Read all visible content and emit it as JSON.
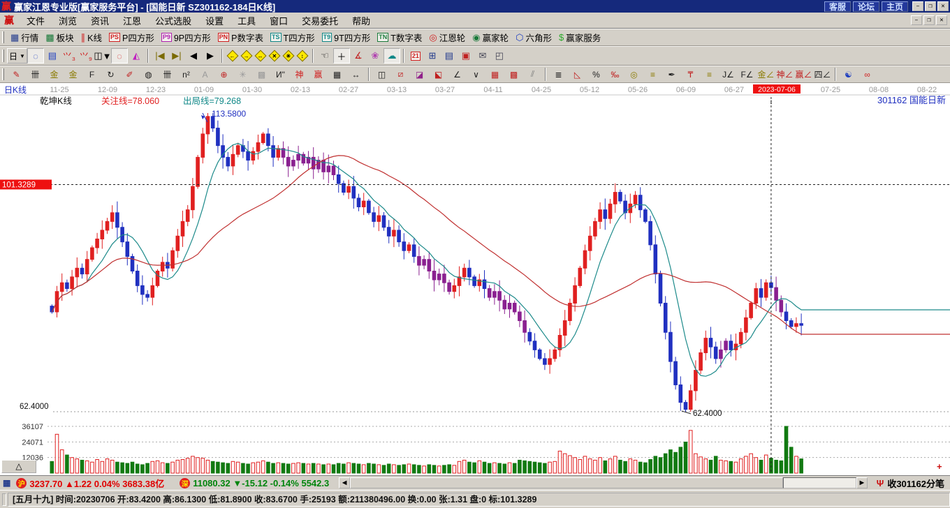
{
  "window": {
    "logo": "赢",
    "title": "赢家江恩专业版[赢家服务平台] - [国能日新  SZ301162-184日K线]",
    "links": [
      {
        "name": "support-link",
        "label": "客服"
      },
      {
        "name": "forum-link",
        "label": "论坛"
      },
      {
        "name": "home-link",
        "label": "主页"
      }
    ],
    "controls": [
      "–",
      "❐",
      "✕"
    ]
  },
  "menu": {
    "logo": "赢",
    "items": [
      {
        "name": "menu-file",
        "label": "文件"
      },
      {
        "name": "menu-browse",
        "label": "浏览"
      },
      {
        "name": "menu-news",
        "label": "资讯"
      },
      {
        "name": "menu-gann",
        "label": "江恩"
      },
      {
        "name": "menu-formula-picker",
        "label": "公式选股"
      },
      {
        "name": "menu-settings",
        "label": "设置"
      },
      {
        "name": "menu-tools",
        "label": "工具"
      },
      {
        "name": "menu-window",
        "label": "窗口"
      },
      {
        "name": "menu-trade",
        "label": "交易委托"
      },
      {
        "name": "menu-help",
        "label": "帮助"
      }
    ]
  },
  "toolbar_main": [
    {
      "name": "quotes-button",
      "icon": "grid-icon",
      "glyph": "▦",
      "color": "#223a8c",
      "label": "行情"
    },
    {
      "name": "sectors-button",
      "icon": "blocks-icon",
      "glyph": "▩",
      "color": "#1a7a3a",
      "label": "板块"
    },
    {
      "name": "kline-button",
      "icon": "candle-icon",
      "glyph": "∥",
      "color": "#d02020",
      "label": "K线"
    },
    {
      "name": "p-square-button",
      "badge": "PS",
      "color": "#d02020",
      "label": "P四方形"
    },
    {
      "name": "p9-square-button",
      "badge": "P9",
      "color": "#b020b0",
      "label": "9P四方形"
    },
    {
      "name": "p-number-table-button",
      "badge": "PN",
      "color": "#d02020",
      "label": "P数字表"
    },
    {
      "name": "t-square-button",
      "badge": "TS",
      "color": "#108888",
      "label": "T四方形"
    },
    {
      "name": "t9-square-button",
      "badge": "T9",
      "color": "#108888",
      "label": "9T四方形"
    },
    {
      "name": "t-number-table-button",
      "badge": "TN",
      "color": "#1a7a3a",
      "label": "T数字表"
    },
    {
      "name": "gann-wheel-button",
      "icon": "gann-wheel-icon",
      "glyph": "◎",
      "color": "#d02020",
      "label": "江恩轮"
    },
    {
      "name": "winner-wheel-button",
      "icon": "winner-wheel-icon",
      "glyph": "◉",
      "color": "#1a7a3a",
      "label": "赢家轮"
    },
    {
      "name": "hexagon-button",
      "icon": "hexagon-icon",
      "glyph": "⬡",
      "color": "#2040c0",
      "label": "六角形"
    },
    {
      "name": "winner-service-button",
      "icon": "dollar-icon",
      "glyph": "$",
      "color": "#2aa82a",
      "label": "赢家服务"
    }
  ],
  "toolbar_nav": {
    "period_label": "日",
    "items": [
      {
        "name": "zoom-select-icon",
        "glyph": "◌",
        "color": "#2040c0",
        "pressed": true
      },
      {
        "name": "info-panel-icon",
        "glyph": "▤",
        "color": "#2040c0"
      },
      {
        "name": "chart3-icon",
        "glyph": "⺍₃",
        "color": "#d02020"
      },
      {
        "name": "chart9-icon",
        "glyph": "⺍₉",
        "color": "#d02020"
      },
      {
        "name": "candle-style-icon",
        "glyph": "◫",
        "color": "#000",
        "caret": true
      },
      {
        "name": "region-lasso-icon",
        "glyph": "◌",
        "color": "#d02020",
        "pressed": true
      },
      {
        "name": "color-chart-icon",
        "glyph": "◭",
        "color": "#c020c0"
      },
      {
        "sep": true
      },
      {
        "name": "first-page-icon",
        "glyph": "|◀",
        "color": "#7a6a00"
      },
      {
        "name": "last-page-icon",
        "glyph": "▶|",
        "color": "#7a6a00"
      },
      {
        "name": "prev-page-icon",
        "glyph": "◀",
        "color": "#000"
      },
      {
        "name": "next-page-icon",
        "glyph": "▶",
        "color": "#000"
      },
      {
        "sep": true
      },
      {
        "name": "shift-left-icon",
        "diamond": true,
        "arrow": "←"
      },
      {
        "name": "shift-right-icon",
        "diamond": true,
        "arrow": "→"
      },
      {
        "name": "expand-h-icon",
        "diamond": true,
        "arrow": "↔"
      },
      {
        "name": "compress-icon",
        "diamond": true,
        "arrow": "✕"
      },
      {
        "name": "zoom-all-icon",
        "diamond": true,
        "arrow": "✳"
      },
      {
        "name": "expand-v-icon",
        "diamond": true,
        "arrow": "↕"
      },
      {
        "sep": true
      },
      {
        "name": "hand-tool-icon",
        "glyph": "☜",
        "color": "#000"
      },
      {
        "name": "crosshair-tool-icon",
        "glyph": "＋",
        "color": "#000",
        "pressed": true
      },
      {
        "name": "angle-measure-icon",
        "glyph": "∡",
        "color": "#c02020"
      },
      {
        "name": "flower-tool-icon",
        "glyph": "❀",
        "color": "#b040b0"
      },
      {
        "name": "cloud-tool-icon",
        "glyph": "☁",
        "color": "#108888",
        "pressed": true
      },
      {
        "sep": true
      },
      {
        "name": "calendar-21-icon",
        "badge": "21",
        "color": "#d02020"
      },
      {
        "name": "calculator-icon",
        "glyph": "⊞",
        "color": "#223a8c"
      },
      {
        "name": "notes-icon",
        "glyph": "▤",
        "color": "#223a8c"
      },
      {
        "name": "save-icon",
        "glyph": "▣",
        "color": "#c02020"
      },
      {
        "name": "send-icon",
        "glyph": "✉",
        "color": "#445"
      },
      {
        "name": "remote-icon",
        "glyph": "◰",
        "color": "#445"
      }
    ]
  },
  "toolbar_draw": [
    {
      "name": "pen-tool-icon",
      "glyph": "✎",
      "color": "#c02020"
    },
    {
      "name": "gann-comb-icon",
      "glyph": "卌",
      "color": "#222"
    },
    {
      "name": "gold-comb-icon",
      "glyph": "金",
      "color": "#8a7a00"
    },
    {
      "name": "gold-comb2-icon",
      "glyph": "金",
      "color": "#8a7a00"
    },
    {
      "name": "f-comb-icon",
      "glyph": "F",
      "color": "#222"
    },
    {
      "name": "spiral-icon",
      "glyph": "↻",
      "color": "#222"
    },
    {
      "name": "brush-icon",
      "glyph": "✐",
      "color": "#c02020"
    },
    {
      "name": "circle-grid-icon",
      "glyph": "◍",
      "color": "#222"
    },
    {
      "name": "comb2-icon",
      "glyph": "卌",
      "color": "#222"
    },
    {
      "name": "n2-icon",
      "glyph": "n²",
      "color": "#222"
    },
    {
      "name": "a-tool-icon",
      "glyph": "A",
      "color": "#999"
    },
    {
      "name": "target-icon",
      "glyph": "⊕",
      "color": "#c02020"
    },
    {
      "name": "star-tool-icon",
      "glyph": "✳",
      "color": "#999"
    },
    {
      "name": "web-tool-icon",
      "glyph": "▩",
      "color": "#999"
    },
    {
      "name": "i-quote-icon",
      "glyph": "И\"",
      "color": "#222"
    },
    {
      "name": "shen-tool-icon",
      "glyph": "神",
      "color": "#d02020"
    },
    {
      "name": "ying-tool-icon",
      "glyph": "赢",
      "color": "#d02020"
    },
    {
      "name": "grid-123-icon",
      "glyph": "▦",
      "color": "#222"
    },
    {
      "name": "width-tool-icon",
      "glyph": "↔",
      "color": "#222"
    },
    {
      "sep": true
    },
    {
      "name": "panel-grid-icon",
      "glyph": "◫",
      "color": "#222"
    },
    {
      "name": "red-fan-icon",
      "glyph": "⧄",
      "color": "#c02020"
    },
    {
      "name": "fan-box-icon",
      "glyph": "◪",
      "color": "#90208a"
    },
    {
      "name": "fan-box2-icon",
      "glyph": "⬕",
      "color": "#c02020"
    },
    {
      "name": "angle-line-icon",
      "glyph": "∠",
      "color": "#222"
    },
    {
      "name": "v-line-icon",
      "glyph": "∨",
      "color": "#222"
    },
    {
      "name": "red-grid-icon",
      "glyph": "▦",
      "color": "#c02020"
    },
    {
      "name": "red-grid2-icon",
      "glyph": "▩",
      "color": "#c02020"
    },
    {
      "name": "multi-line-icon",
      "glyph": "⫽",
      "color": "#777"
    },
    {
      "sep": true
    },
    {
      "name": "percent-comb-icon",
      "glyph": "≣",
      "color": "#222"
    },
    {
      "name": "percent-tri-icon",
      "glyph": "◺",
      "color": "#c02020"
    },
    {
      "name": "percent-icon",
      "glyph": "%",
      "color": "#222"
    },
    {
      "name": "permille-icon",
      "glyph": "‰",
      "color": "#c02020"
    },
    {
      "name": "gold-circle-icon",
      "glyph": "◎",
      "color": "#8a7a00"
    },
    {
      "name": "gold-lines-icon",
      "glyph": "≡",
      "color": "#8a7a00"
    },
    {
      "name": "ink-pen-icon",
      "glyph": "✒",
      "color": "#222"
    },
    {
      "name": "support-line-icon",
      "glyph": "₸",
      "color": "#c02020"
    },
    {
      "name": "gold-eq-icon",
      "glyph": "≡",
      "color": "#8a7a00"
    },
    {
      "name": "j-angle-icon",
      "glyph": "J∠",
      "color": "#222"
    },
    {
      "name": "f-angle-icon",
      "glyph": "F∠",
      "color": "#222"
    },
    {
      "name": "gold-angle-icon",
      "glyph": "金∠",
      "color": "#8a7a00"
    },
    {
      "name": "shen-angle-icon",
      "glyph": "神∠",
      "color": "#c02020"
    },
    {
      "name": "ying-angle-icon",
      "glyph": "赢∠",
      "color": "#c02020"
    },
    {
      "name": "four-angle-icon",
      "glyph": "四∠",
      "color": "#222"
    },
    {
      "sep": true
    },
    {
      "name": "taiji-icon",
      "glyph": "☯",
      "color": "#2040c0"
    },
    {
      "name": "infinity-icon",
      "glyph": "∞",
      "color": "#d02020"
    }
  ],
  "chart": {
    "period_label": "日K线",
    "indicator_label": "乾坤K线",
    "attention_line_label": "关注线=78.060",
    "exit_line_label": "出局线=79.268",
    "stock_label": "301162 国能日新",
    "high_label": "113.5800",
    "low_label": "62.4000",
    "left_low_label": "62.4000",
    "price_tag": "101.3289",
    "highlight_date": "2023-07-06",
    "dates": [
      "11-25",
      "12-09",
      "12-23",
      "01-09",
      "01-30",
      "02-13",
      "02-27",
      "03-13",
      "03-27",
      "04-11",
      "04-25",
      "05-12",
      "05-26",
      "06-09",
      "06-27",
      "07-25",
      "08-08",
      "08-22"
    ],
    "volume_ticks": [
      "36107",
      "24071",
      "12036"
    ],
    "tri_button": "△",
    "plus_marker": "+",
    "colors": {
      "up": "#e02020",
      "down": "#2030c0",
      "neutral": "#8a2090",
      "ma_short": "#1c8a8a",
      "ma_long": "#c03030",
      "vol_up": "#e02020",
      "vol_down": "#127a12",
      "date_highlight_bg": "#ee1111",
      "label_blue": "#2030c0"
    }
  },
  "chart_data": {
    "type": "candlestick+volume",
    "price_min": 62.4,
    "price_max": 113.58,
    "marker_value": 101.3289,
    "attention_value": 78.06,
    "exit_value": 79.268,
    "first_open": 80.5,
    "highlight_index": 143,
    "purple_ranges": [
      [
        46,
        56
      ],
      [
        73,
        79
      ],
      [
        87,
        94
      ],
      [
        133,
        134
      ],
      [
        144,
        145
      ]
    ],
    "closes": [
      79.5,
      83,
      84.5,
      83.5,
      85.5,
      87,
      86,
      88.5,
      90.5,
      92,
      93.5,
      95,
      96.5,
      94,
      91.5,
      89,
      86.5,
      84,
      82.5,
      82,
      84,
      86.5,
      88,
      87,
      90,
      92.5,
      95,
      97,
      101,
      106,
      110,
      113,
      111,
      108,
      106,
      104.5,
      106.5,
      108,
      107,
      105.5,
      107,
      108.5,
      110,
      108,
      106,
      107.5,
      106,
      104.5,
      105.5,
      106.5,
      105,
      106,
      104,
      105.5,
      103.5,
      104.5,
      103,
      101.5,
      100,
      101,
      99,
      97.5,
      98.5,
      96.5,
      95,
      96,
      94,
      92.5,
      93.5,
      91.5,
      90,
      91,
      89,
      87.5,
      88.5,
      86.5,
      85,
      86,
      84.5,
      83,
      84,
      85.5,
      87,
      85.5,
      84,
      85,
      83.5,
      82,
      83,
      81.5,
      80,
      81,
      79.5,
      78,
      76,
      74.5,
      73,
      71.5,
      70.5,
      71.5,
      73,
      75.5,
      78,
      81,
      84,
      87,
      90,
      92.5,
      95,
      97,
      95.5,
      98,
      100,
      98.5,
      96.5,
      98,
      99.5,
      97,
      95,
      91,
      86,
      81,
      76,
      71,
      67,
      64,
      62.8,
      66,
      69.5,
      72.5,
      75,
      73.5,
      71.5,
      73,
      74.5,
      73,
      74,
      76,
      78.5,
      81,
      83.5,
      82,
      84.5,
      83.67,
      81.5,
      79.5,
      78,
      77,
      77.5,
      77.2
    ],
    "volumes": [
      9000,
      30000,
      18000,
      14000,
      12000,
      11000,
      10000,
      9500,
      8500,
      10500,
      9000,
      11000,
      10000,
      8500,
      8000,
      7500,
      8500,
      7000,
      6500,
      7500,
      9000,
      9500,
      8000,
      7500,
      8500,
      10000,
      10500,
      11500,
      13000,
      12000,
      11500,
      10000,
      9000,
      8500,
      8000,
      7500,
      9000,
      8500,
      7500,
      7000,
      8000,
      8500,
      9500,
      8500,
      7500,
      8000,
      7500,
      7000,
      7500,
      8000,
      7500,
      7000,
      7500,
      7000,
      6500,
      7000,
      6500,
      7500,
      7000,
      8000,
      7500,
      7000,
      6500,
      7500,
      7000,
      6500,
      6000,
      7000,
      6500,
      6000,
      6500,
      7000,
      6500,
      6000,
      5500,
      6500,
      6000,
      5500,
      6000,
      6500,
      6000,
      9000,
      10000,
      8500,
      8000,
      9500,
      8500,
      7500,
      8000,
      7500,
      7000,
      8000,
      7500,
      10000,
      9500,
      9000,
      8500,
      8000,
      7500,
      8500,
      9000,
      17000,
      15000,
      13500,
      12000,
      10500,
      13000,
      11000,
      10000,
      12000,
      9500,
      11000,
      13000,
      10000,
      9000,
      11000,
      10000,
      8500,
      8000,
      10500,
      13000,
      12000,
      15000,
      18000,
      16000,
      20000,
      24000,
      33000,
      15000,
      12500,
      11000,
      10000,
      13000,
      10000,
      9500,
      9000,
      8500,
      11000,
      13000,
      15000,
      12000,
      10000,
      14000,
      11500,
      10000,
      9500,
      36107,
      20000,
      13000,
      11000
    ]
  },
  "market_bar": {
    "grid_icon": "▦",
    "sh_badge": "沪",
    "sh_text": "3237.70 ▲1.22 0.04% 3683.38亿",
    "sz_badge": "深",
    "sz_text": "11080.32 ▼-15.12 -0.14% 5542.3",
    "feed_icon": "Ψ",
    "feed_text": "收301162分笔"
  },
  "status_bar": {
    "lunar": "[五月十九]",
    "fields": [
      "时间:20230706",
      "开:83.4200",
      "高:86.1300",
      "低:81.8900",
      "收:83.6700",
      "手:25193",
      "额:211380496.00",
      "换:0.00",
      "张:1.31",
      "盘:0",
      "标:101.3289"
    ]
  }
}
